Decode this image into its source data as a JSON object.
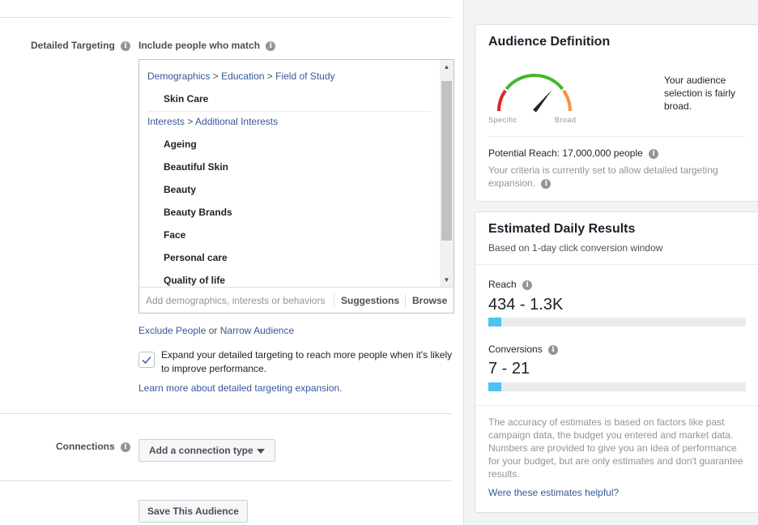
{
  "targeting": {
    "label": "Detailed Targeting",
    "include_label": "Include people who match",
    "groups": [
      {
        "crumbs": [
          "Demographics",
          "Education",
          "Field of Study"
        ],
        "items": [
          "Skin Care"
        ]
      },
      {
        "crumbs": [
          "Interests",
          "Additional Interests"
        ],
        "items": [
          "Ageing",
          "Beautiful Skin",
          "Beauty",
          "Beauty Brands",
          "Face",
          "Personal care",
          "Quality of life"
        ]
      }
    ],
    "search_placeholder": "Add demographics, interests or behaviors",
    "suggestions_label": "Suggestions",
    "browse_label": "Browse",
    "exclude_link": "Exclude People",
    "or_text": "or",
    "narrow_link": "Narrow Audience",
    "expand_checked": true,
    "expand_text": "Expand your detailed targeting to reach more people when it's likely to improve performance.",
    "learn_more": "Learn more about detailed targeting expansion."
  },
  "connections": {
    "label": "Connections",
    "button": "Add a connection type"
  },
  "save_button": "Save This Audience",
  "audience_definition": {
    "title": "Audience Definition",
    "gauge_left": "Specific",
    "gauge_right": "Broad",
    "gauge_level": 0.72,
    "description": "Your audience selection is fairly broad.",
    "potential_reach": "Potential Reach: 17,000,000 people",
    "criteria_note": "Your criteria is currently set to allow detailed targeting expansion.",
    "colors": {
      "red": "#e02424",
      "green": "#42b72a",
      "orange": "#f7923b"
    }
  },
  "estimated": {
    "title": "Estimated Daily Results",
    "subtitle": "Based on 1-day click conversion window",
    "reach_label": "Reach",
    "reach_value": "434 - 1.3K",
    "reach_fill": 0.05,
    "conversions_label": "Conversions",
    "conversions_value": "7 - 21",
    "conversions_fill": 0.05,
    "disclaimer": "The accuracy of estimates is based on factors like past campaign data, the budget you entered and market data. Numbers are provided to give you an idea of performance for your budget, but are only estimates and don't guarantee results.",
    "helpful_link": "Were these estimates helpful?",
    "bar_color": "#4cc3f0"
  }
}
